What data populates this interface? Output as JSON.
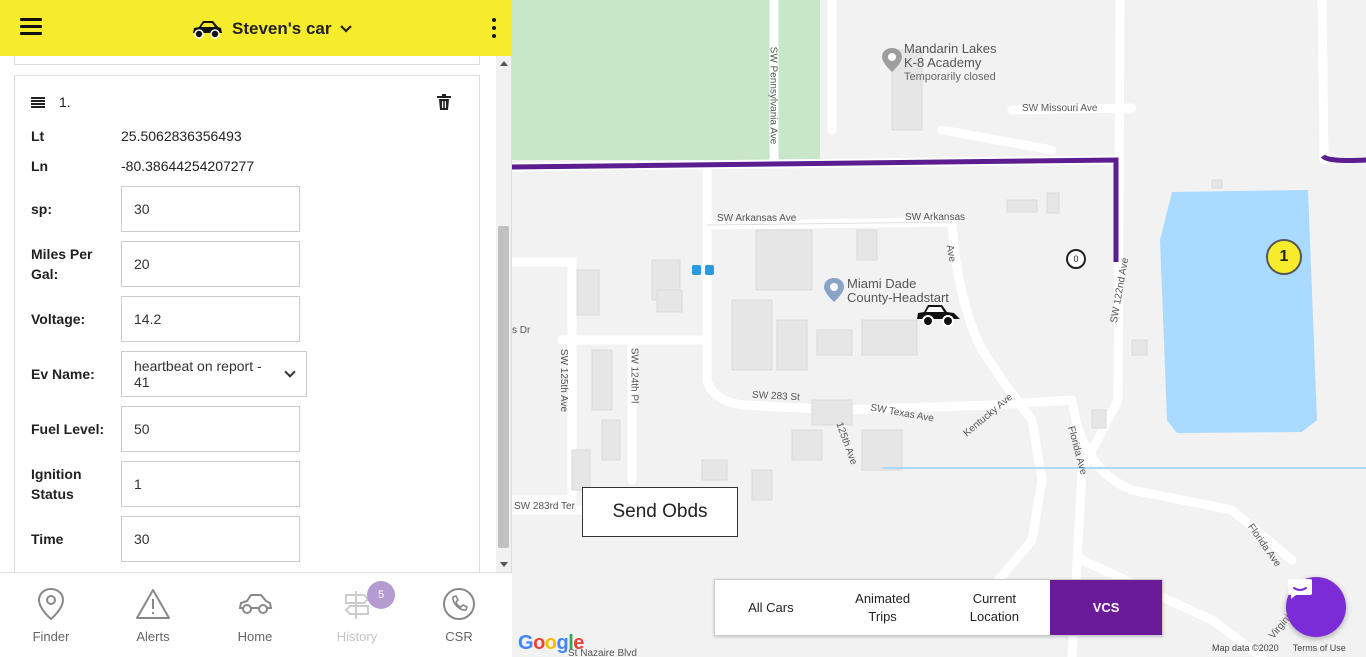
{
  "header": {
    "title": "Steven's car"
  },
  "record": {
    "number": "1.",
    "lt_label": "Lt",
    "lt_value": "25.5062836356493",
    "ln_label": "Ln",
    "ln_value": "-80.38644254207277",
    "fields": {
      "sp": {
        "label": "sp:",
        "value": "30"
      },
      "mpg": {
        "label": "Miles Per Gal:",
        "value": "20"
      },
      "voltage": {
        "label": "Voltage:",
        "value": "14.2"
      },
      "ev_name": {
        "label": "Ev Name:",
        "value": "heartbeat on report - 41"
      },
      "fuel": {
        "label": "Fuel Level:",
        "value": "50"
      },
      "ignition": {
        "label": "Ignition Status",
        "value": "1"
      },
      "time": {
        "label": "Time",
        "value": "30"
      }
    }
  },
  "bottom_nav": {
    "finder": "Finder",
    "alerts": "Alerts",
    "home": "Home",
    "history": "History",
    "history_badge": "5",
    "csr": "CSR"
  },
  "map": {
    "send_button": "Send Obds",
    "tabs": {
      "all_cars": "All Cars",
      "animated": "Animated\nTrips",
      "current": "Current\nLocation",
      "vcs": "VCS"
    },
    "cluster_count": "1",
    "small_marker": "0",
    "poi_school": "Mandarin Lakes",
    "poi_school_2": "K-8 Academy",
    "poi_school_status": "Temporarily closed",
    "poi_headstart": "Miami Dade",
    "poi_headstart_2": "County-Headstart",
    "streets": {
      "missouri": "SW Missouri Ave",
      "arkansas1": "SW Arkansas Ave",
      "arkansas2": "SW Arkansas",
      "arkansas3": "Ave",
      "pennsylvania": "SW Pennsylvania Ave",
      "s122": "SW 122nd Ave",
      "s125": "SW 125th Ave",
      "s124": "SW 124th Pl",
      "s283": "SW 283 St",
      "texas": "SW Texas Ave",
      "kentucky": "Kentucky Ave",
      "n125": "125th Ave",
      "florida": "Florida Ave",
      "florida2": "Florida Ave",
      "s283ter": "SW 283rd Ter",
      "dr": "s Dr",
      "virginia": "Virginia Ave",
      "nazaire": "St Nazaire Blvd"
    },
    "google": "Google",
    "map_data": "Map data ©2020",
    "terms": "Terms of Use"
  },
  "colors": {
    "header_yellow": "#f7ec2c",
    "accent_purple": "#6a1b9a",
    "route_purple": "#5b1d8f",
    "chat_purple": "#7b2cd6",
    "water_blue": "#aadaff",
    "park_green": "#c8e6c9"
  }
}
